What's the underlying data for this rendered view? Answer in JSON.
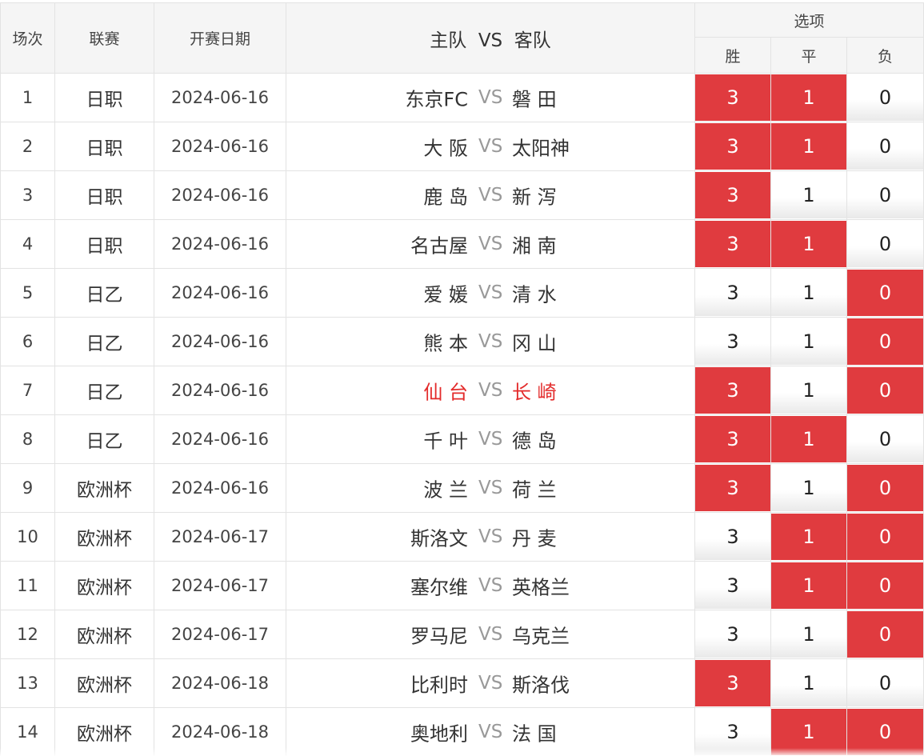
{
  "header": {
    "col_no": "场次",
    "col_league": "联赛",
    "col_date": "开赛日期",
    "col_home": "主队",
    "col_vs": "VS",
    "col_away": "客队",
    "col_options": "选项",
    "opt_win": "胜",
    "opt_draw": "平",
    "opt_loss": "负"
  },
  "vs_text": "VS",
  "colors": {
    "selected": "#e03b3f",
    "highlight_team": "#e32b2b"
  },
  "matches": [
    {
      "no": "1",
      "league": "日职",
      "date": "2024-06-16",
      "home": "东京FC",
      "away": "磐 田",
      "highlight": false,
      "win": "3",
      "draw": "1",
      "loss": "0",
      "win_sel": true,
      "draw_sel": true,
      "loss_sel": false
    },
    {
      "no": "2",
      "league": "日职",
      "date": "2024-06-16",
      "home": "大 阪",
      "away": "太阳神",
      "highlight": false,
      "win": "3",
      "draw": "1",
      "loss": "0",
      "win_sel": true,
      "draw_sel": true,
      "loss_sel": false
    },
    {
      "no": "3",
      "league": "日职",
      "date": "2024-06-16",
      "home": "鹿 岛",
      "away": "新 泻",
      "highlight": false,
      "win": "3",
      "draw": "1",
      "loss": "0",
      "win_sel": true,
      "draw_sel": false,
      "loss_sel": false
    },
    {
      "no": "4",
      "league": "日职",
      "date": "2024-06-16",
      "home": "名古屋",
      "away": "湘 南",
      "highlight": false,
      "win": "3",
      "draw": "1",
      "loss": "0",
      "win_sel": true,
      "draw_sel": true,
      "loss_sel": false
    },
    {
      "no": "5",
      "league": "日乙",
      "date": "2024-06-16",
      "home": "爱 媛",
      "away": "清 水",
      "highlight": false,
      "win": "3",
      "draw": "1",
      "loss": "0",
      "win_sel": false,
      "draw_sel": false,
      "loss_sel": true
    },
    {
      "no": "6",
      "league": "日乙",
      "date": "2024-06-16",
      "home": "熊 本",
      "away": "冈 山",
      "highlight": false,
      "win": "3",
      "draw": "1",
      "loss": "0",
      "win_sel": false,
      "draw_sel": false,
      "loss_sel": true
    },
    {
      "no": "7",
      "league": "日乙",
      "date": "2024-06-16",
      "home": "仙 台",
      "away": "长 崎",
      "highlight": true,
      "win": "3",
      "draw": "1",
      "loss": "0",
      "win_sel": true,
      "draw_sel": false,
      "loss_sel": true
    },
    {
      "no": "8",
      "league": "日乙",
      "date": "2024-06-16",
      "home": "千 叶",
      "away": "德 岛",
      "highlight": false,
      "win": "3",
      "draw": "1",
      "loss": "0",
      "win_sel": true,
      "draw_sel": true,
      "loss_sel": false
    },
    {
      "no": "9",
      "league": "欧洲杯",
      "date": "2024-06-16",
      "home": "波 兰",
      "away": "荷 兰",
      "highlight": false,
      "win": "3",
      "draw": "1",
      "loss": "0",
      "win_sel": true,
      "draw_sel": false,
      "loss_sel": true
    },
    {
      "no": "10",
      "league": "欧洲杯",
      "date": "2024-06-17",
      "home": "斯洛文",
      "away": "丹 麦",
      "highlight": false,
      "win": "3",
      "draw": "1",
      "loss": "0",
      "win_sel": false,
      "draw_sel": true,
      "loss_sel": true
    },
    {
      "no": "11",
      "league": "欧洲杯",
      "date": "2024-06-17",
      "home": "塞尔维",
      "away": "英格兰",
      "highlight": false,
      "win": "3",
      "draw": "1",
      "loss": "0",
      "win_sel": false,
      "draw_sel": true,
      "loss_sel": true
    },
    {
      "no": "12",
      "league": "欧洲杯",
      "date": "2024-06-17",
      "home": "罗马尼",
      "away": "乌克兰",
      "highlight": false,
      "win": "3",
      "draw": "1",
      "loss": "0",
      "win_sel": false,
      "draw_sel": false,
      "loss_sel": true
    },
    {
      "no": "13",
      "league": "欧洲杯",
      "date": "2024-06-18",
      "home": "比利时",
      "away": "斯洛伐",
      "highlight": false,
      "win": "3",
      "draw": "1",
      "loss": "0",
      "win_sel": true,
      "draw_sel": false,
      "loss_sel": false
    },
    {
      "no": "14",
      "league": "欧洲杯",
      "date": "2024-06-18",
      "home": "奥地利",
      "away": "法 国",
      "highlight": false,
      "win": "3",
      "draw": "1",
      "loss": "0",
      "win_sel": false,
      "draw_sel": true,
      "loss_sel": true
    }
  ]
}
